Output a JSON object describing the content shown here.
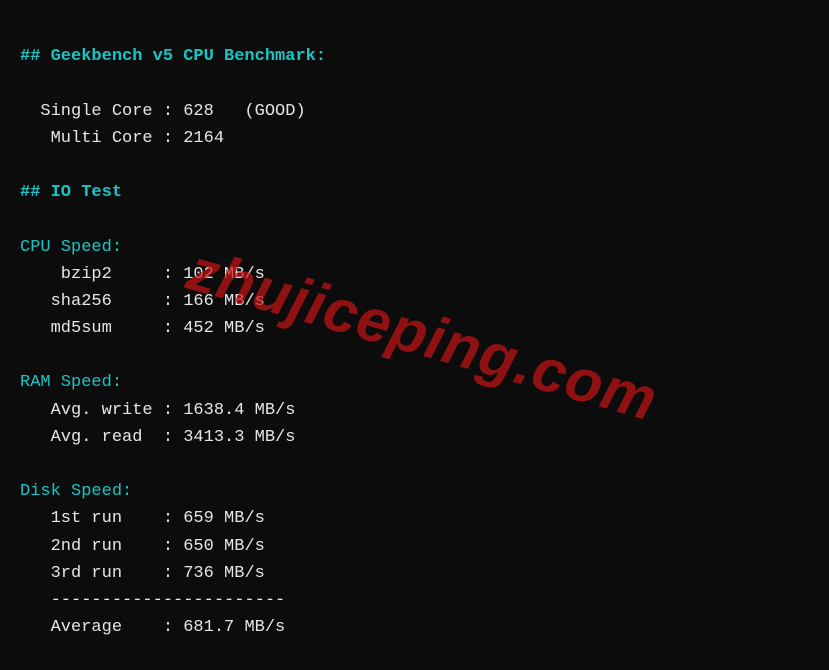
{
  "geekbench": {
    "heading": "## Geekbench v5 CPU Benchmark:",
    "single_label": "  Single Core : ",
    "single_value": "628   (GOOD)",
    "multi_label": "   Multi Core : ",
    "multi_value": "2164"
  },
  "io": {
    "heading": "## IO Test"
  },
  "cpu": {
    "heading": "CPU Speed:",
    "bzip2_label": "    bzip2     : ",
    "bzip2_value": "102 MB/s",
    "sha256_label": "   sha256     : ",
    "sha256_value": "166 MB/s",
    "md5sum_label": "   md5sum     : ",
    "md5sum_value": "452 MB/s"
  },
  "ram": {
    "heading": "RAM Speed:",
    "write_label": "   Avg. write : ",
    "write_value": "1638.4 MB/s",
    "read_label": "   Avg. read  : ",
    "read_value": "3413.3 MB/s"
  },
  "disk": {
    "heading": "Disk Speed:",
    "run1_label": "   1st run    : ",
    "run1_value": "659 MB/s",
    "run2_label": "   2nd run    : ",
    "run2_value": "650 MB/s",
    "run3_label": "   3rd run    : ",
    "run3_value": "736 MB/s",
    "divider": "   -----------------------",
    "avg_label": "   Average    : ",
    "avg_value": "681.7 MB/s"
  },
  "watermark": "zhujiceping.com"
}
